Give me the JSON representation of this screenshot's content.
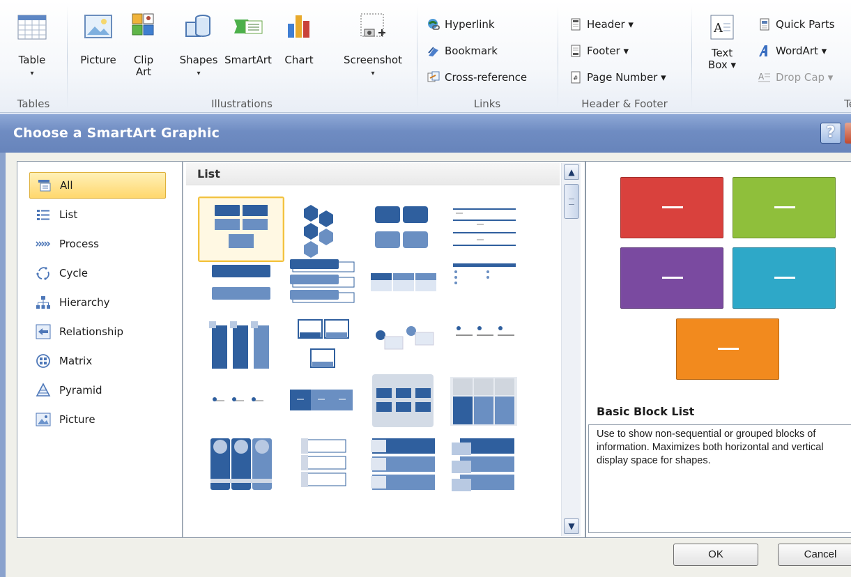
{
  "ribbon": {
    "groups": {
      "tables": "Tables",
      "illustrations": "Illustrations",
      "links": "Links",
      "header_footer": "Header & Footer",
      "text_partial": "Te"
    },
    "buttons": {
      "table": "Table",
      "picture": "Picture",
      "clip_art_1": "Clip",
      "clip_art_2": "Art",
      "shapes": "Shapes",
      "smartart": "SmartArt",
      "chart": "Chart",
      "screenshot": "Screenshot",
      "hyperlink": "Hyperlink",
      "bookmark": "Bookmark",
      "cross_reference": "Cross-reference",
      "header": "Header ▾",
      "footer": "Footer ▾",
      "page_number": "Page Number ▾",
      "text_box_1": "Text",
      "text_box_2": "Box ▾",
      "quick_parts": "Quick Parts",
      "wordart": "WordArt ▾",
      "drop_cap": "Drop Cap ▾"
    },
    "arrow": "▾"
  },
  "dialog": {
    "title": "Choose a SmartArt Graphic",
    "help": "?",
    "categories": [
      {
        "label": "All",
        "icon": "all-icon",
        "selected": true
      },
      {
        "label": "List",
        "icon": "list-icon"
      },
      {
        "label": "Process",
        "icon": "process-icon"
      },
      {
        "label": "Cycle",
        "icon": "cycle-icon"
      },
      {
        "label": "Hierarchy",
        "icon": "hierarchy-icon"
      },
      {
        "label": "Relationship",
        "icon": "relationship-icon"
      },
      {
        "label": "Matrix",
        "icon": "matrix-icon"
      },
      {
        "label": "Pyramid",
        "icon": "pyramid-icon"
      },
      {
        "label": "Picture",
        "icon": "picture-icon"
      }
    ],
    "gallery_header": "List",
    "selected_layout": "Basic Block List",
    "preview_title": "Basic Block List",
    "preview_description": "Use to show non-sequential or grouped blocks of information. Maximizes both horizontal and vertical display space for shapes.",
    "preview_colors": [
      "#d9413d",
      "#8fbf3b",
      "#7a4aa0",
      "#2ea8c8",
      "#f28a1e"
    ],
    "ok": "OK",
    "cancel": "Cancel",
    "scroll_up": "▲",
    "scroll_down": "▼"
  }
}
